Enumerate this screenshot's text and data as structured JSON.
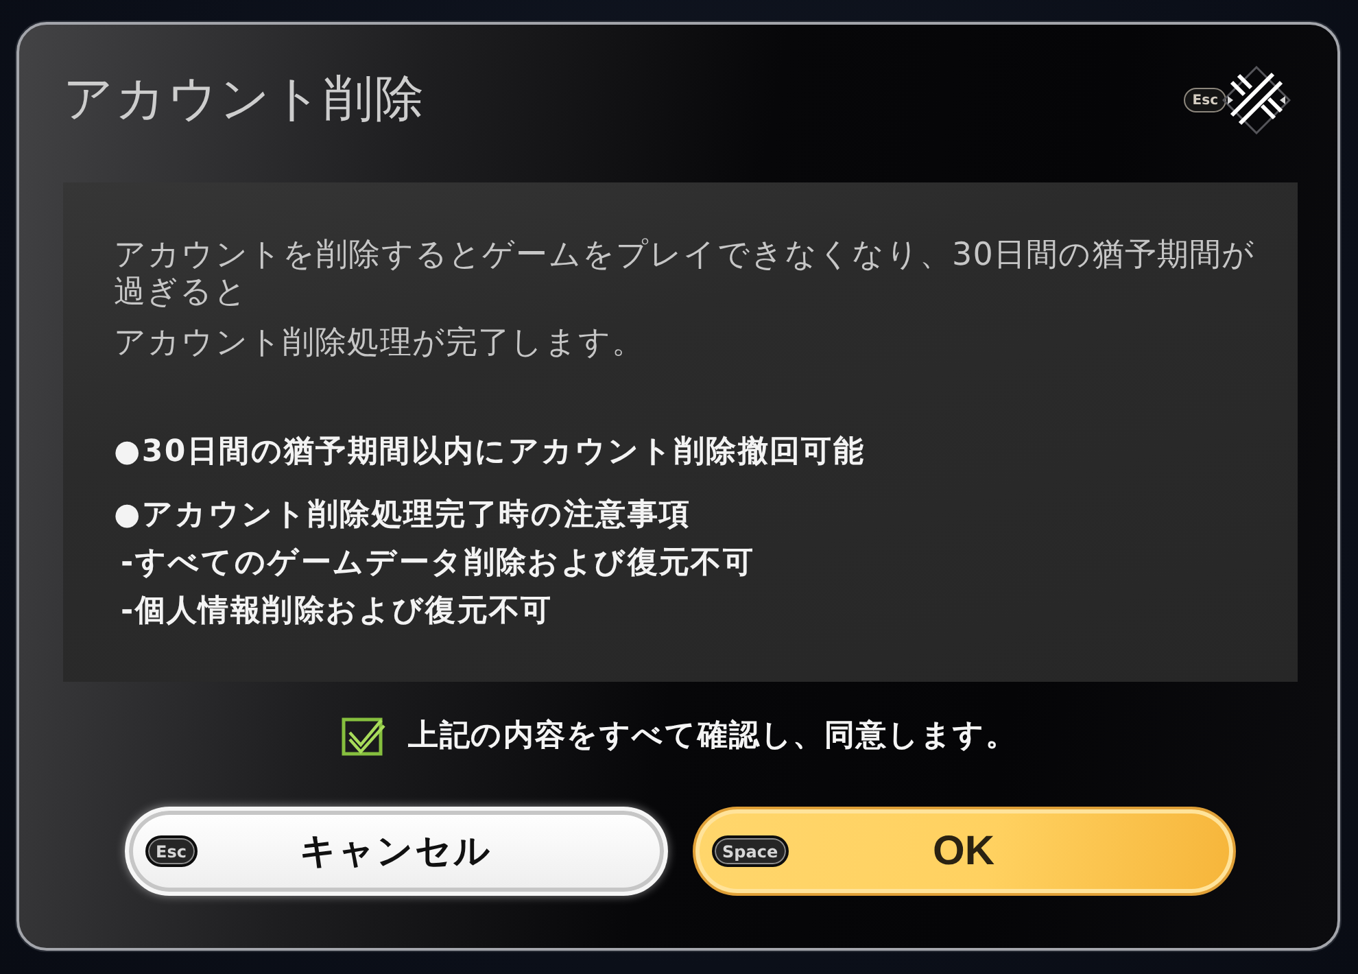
{
  "dialog": {
    "title": "アカウント削除",
    "close": {
      "key_hint": "Esc"
    }
  },
  "notice": {
    "paragraphs": [
      "アカウントを削除するとゲームをプレイできなくなり、30日間の猶予期間が過ぎると",
      "アカウント削除処理が完了します。"
    ],
    "items": [
      {
        "kind": "bullet",
        "text": "●30日間の猶予期間以内にアカウント削除撤回可能"
      },
      {
        "kind": "bullet",
        "text": "●アカウント削除処理完了時の注意事項"
      },
      {
        "kind": "sub",
        "text": "-すべてのゲームデータ削除および復元不可"
      },
      {
        "kind": "sub",
        "text": "-個人情報削除および復元不可"
      }
    ]
  },
  "agreement": {
    "label": "上記の内容をすべて確認し、同意します。",
    "checked": true
  },
  "buttons": [
    {
      "kind": "secondary",
      "key_hint": "Esc",
      "label": "キャンセル"
    },
    {
      "kind": "primary",
      "key_hint": "Space",
      "label": "OK"
    }
  ]
}
